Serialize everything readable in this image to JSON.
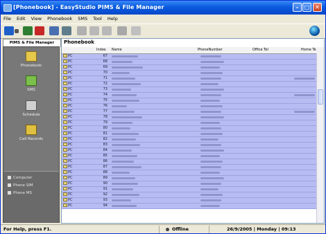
{
  "window": {
    "title": "[Phonebook] - EasyStudio PIMS & File Manager"
  },
  "menubar": [
    "File",
    "Edit",
    "View",
    "Phonebook",
    "SMS",
    "Tool",
    "Help"
  ],
  "left_panel": {
    "tab_label": "PIMS & File Manager",
    "nav": [
      {
        "label": "Phonebook",
        "icon": "phonebook-icon"
      },
      {
        "label": "SMS",
        "icon": "sms-icon"
      },
      {
        "label": "Schedule",
        "icon": "schedule-icon"
      },
      {
        "label": "Call Records",
        "icon": "call-records-icon"
      }
    ],
    "devices": [
      "Computer",
      "Phone SIM",
      "Phone MS"
    ]
  },
  "phonebook": {
    "title": "Phonebook",
    "columns": [
      "Index",
      "Name",
      "PhoneNumber",
      "Office Tel",
      "Home Te"
    ],
    "location": "PC",
    "rows": [
      "67",
      "68",
      "69",
      "70",
      "71",
      "72",
      "73",
      "74",
      "75",
      "76",
      "77",
      "78",
      "79",
      "80",
      "81",
      "82",
      "83",
      "84",
      "85",
      "86",
      "87",
      "88",
      "89",
      "90",
      "91",
      "92",
      "93",
      "94"
    ]
  },
  "statusbar": {
    "help": "For Help, press F1.",
    "connection": "Offline",
    "datetime": "26/9/2005 | Monday | 09:13"
  },
  "colors": {
    "titlebar": "#0a5be0",
    "row_bg": "#b7bdf2",
    "panel_bg": "#787878"
  }
}
